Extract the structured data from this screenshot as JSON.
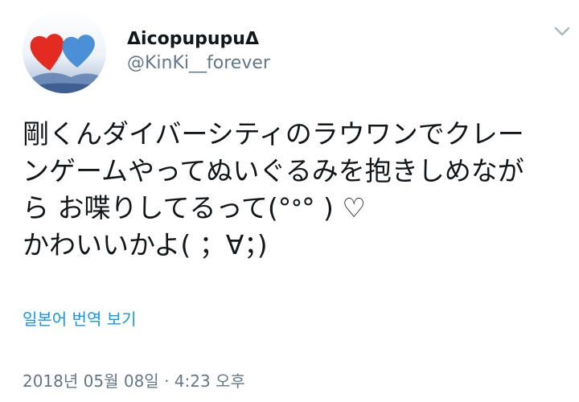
{
  "user": {
    "display_name": "ᐃicopupupuᐃ",
    "handle": "@KinKi__forever",
    "avatar_icon": "two-hearts-avatar",
    "colors": {
      "heart_left": "#e32b22",
      "heart_right": "#4b8fd6"
    }
  },
  "header": {
    "menu_icon": "chevron-down-icon"
  },
  "tweet": {
    "lines": [
      "剛くんダイバーシティのラウワンでクレー",
      "ンゲームやってぬいぐるみを抱きしめなが",
      "ら お喋りしてるって(°ᐤ° ) ♡",
      "かわいいかよ( ；∀；)"
    ]
  },
  "translate": {
    "label": "일본어 번역 보기"
  },
  "meta": {
    "timestamp": "2018년 05월 08일 · 4:23 오후"
  },
  "theme": {
    "text": "#14171a",
    "secondary": "#657786",
    "link": "#1b95e0"
  }
}
